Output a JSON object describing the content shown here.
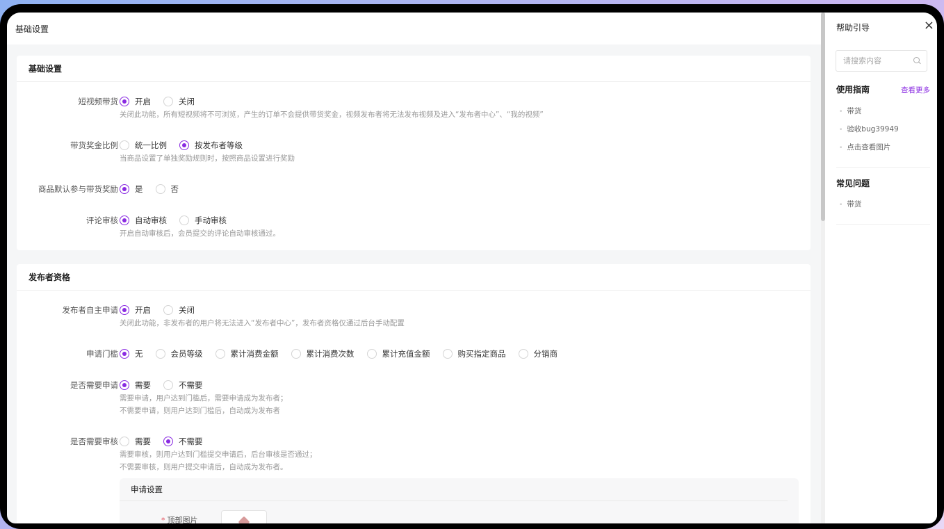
{
  "page": {
    "title": "基础设置"
  },
  "colors": {
    "accent": "#8a2be2",
    "hint": "#999999"
  },
  "basic": {
    "header": "基础设置",
    "rows": [
      {
        "label": "短视频带货",
        "options": [
          "开启",
          "关闭"
        ],
        "selected": 0,
        "hint": "关闭此功能，所有短视频将不可浏览，产生的订单不会提供带货奖金，视频发布者将无法发布视频及进入“发布者中心”、“我的视频”"
      },
      {
        "label": "带货奖金比例",
        "options": [
          "统一比例",
          "按发布者等级"
        ],
        "selected": 1,
        "hint": "当商品设置了单独奖励规则时，按照商品设置进行奖励"
      },
      {
        "label": "商品默认参与带货奖励",
        "options": [
          "是",
          "否"
        ],
        "selected": 0
      },
      {
        "label": "评论审核",
        "options": [
          "自动审核",
          "手动审核"
        ],
        "selected": 0,
        "hint": "开启自动审核后，会员提交的评论自动审核通过。"
      }
    ]
  },
  "publisher": {
    "header": "发布者资格",
    "rows": [
      {
        "label": "发布者自主申请",
        "options": [
          "开启",
          "关闭"
        ],
        "selected": 0,
        "hint": "关闭此功能，非发布者的用户将无法进入“发布者中心”，发布者资格仅通过后台手动配置"
      },
      {
        "label": "申请门槛",
        "options": [
          "无",
          "会员等级",
          "累计消费金额",
          "累计消费次数",
          "累计充值金额",
          "购买指定商品",
          "分销商"
        ],
        "selected": 0
      },
      {
        "label": "是否需要申请",
        "options": [
          "需要",
          "不需要"
        ],
        "selected": 0,
        "hint": "需要申请，用户达到门槛后，需要申请成为发布者；",
        "hint2": "不需要申请，则用户达到门槛后，自动成为发布者"
      },
      {
        "label": "是否需要审核",
        "options": [
          "需要",
          "不需要"
        ],
        "selected": 1,
        "hint": "需要审核，则用户达到门槛提交申请后，后台审核是否通过；",
        "hint2": "不需要审核，则用户提交申请后，自动成为发布者。"
      }
    ],
    "sub": {
      "title": "申请设置",
      "field_label": "顶部图片",
      "required_mark": "*"
    }
  },
  "help": {
    "title": "帮助引导",
    "close": "×",
    "search_placeholder": "请搜索内容",
    "guide_title": "使用指南",
    "more": "查看更多",
    "guide_items": [
      "带货",
      "验收bug39949",
      "点击查看图片"
    ],
    "faq_title": "常见问题",
    "faq_items": [
      "带货"
    ]
  }
}
